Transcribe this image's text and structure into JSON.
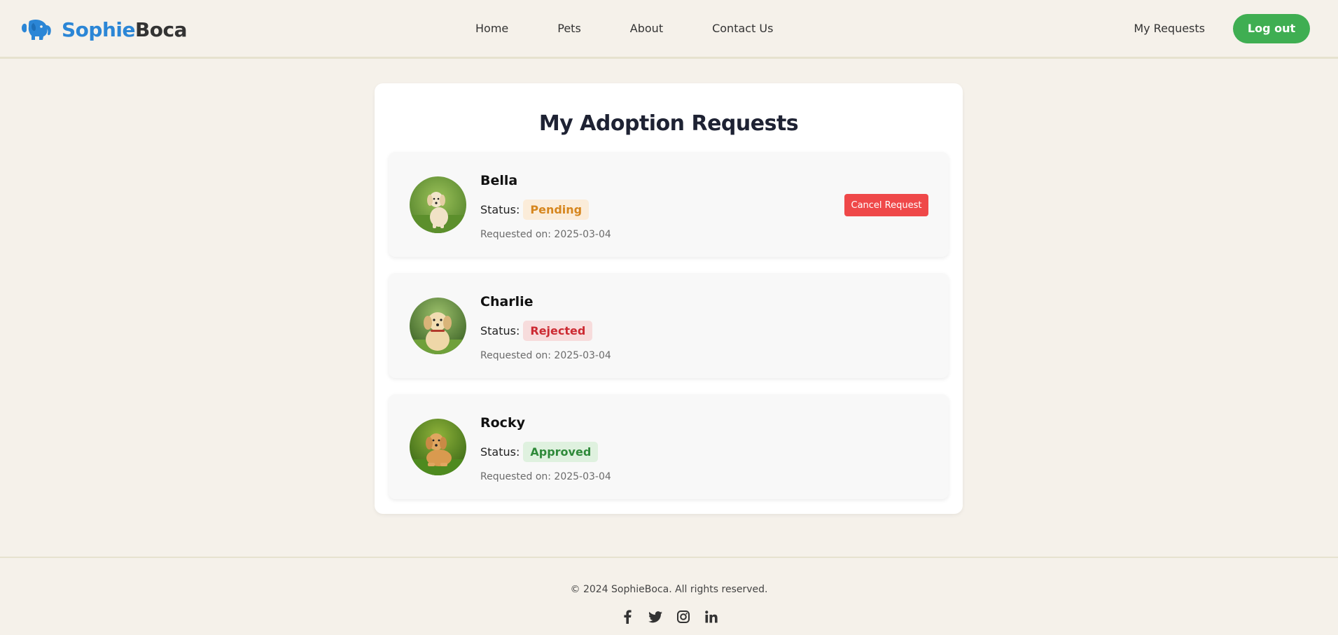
{
  "brand": {
    "name_part1": "Sophie",
    "name_part2": "Boca",
    "accent_color": "#2b86d6"
  },
  "nav": {
    "links": [
      "Home",
      "Pets",
      "About",
      "Contact Us"
    ],
    "my_requests": "My Requests",
    "logout": "Log out"
  },
  "main": {
    "title": "My Adoption Requests",
    "status_label": "Status:",
    "requests": [
      {
        "pet_name": "Bella",
        "status": "Pending",
        "requested_on": "Requested on: 2025-03-04",
        "action": "Cancel Request"
      },
      {
        "pet_name": "Charlie",
        "status": "Rejected",
        "requested_on": "Requested on: 2025-03-04"
      },
      {
        "pet_name": "Rocky",
        "status": "Approved",
        "requested_on": "Requested on: 2025-03-04"
      }
    ]
  },
  "footer": {
    "copyright": "© 2024 SophieBoca. All rights reserved.",
    "social_icons": [
      "facebook-icon",
      "twitter-icon",
      "instagram-icon",
      "linkedin-icon"
    ]
  },
  "colors": {
    "background": "#f5f1ea",
    "logout_button": "#3fae52",
    "cancel_button": "#ef4849",
    "pending": "#d6861e",
    "rejected": "#cc2a32",
    "approved": "#2f8a3a"
  }
}
